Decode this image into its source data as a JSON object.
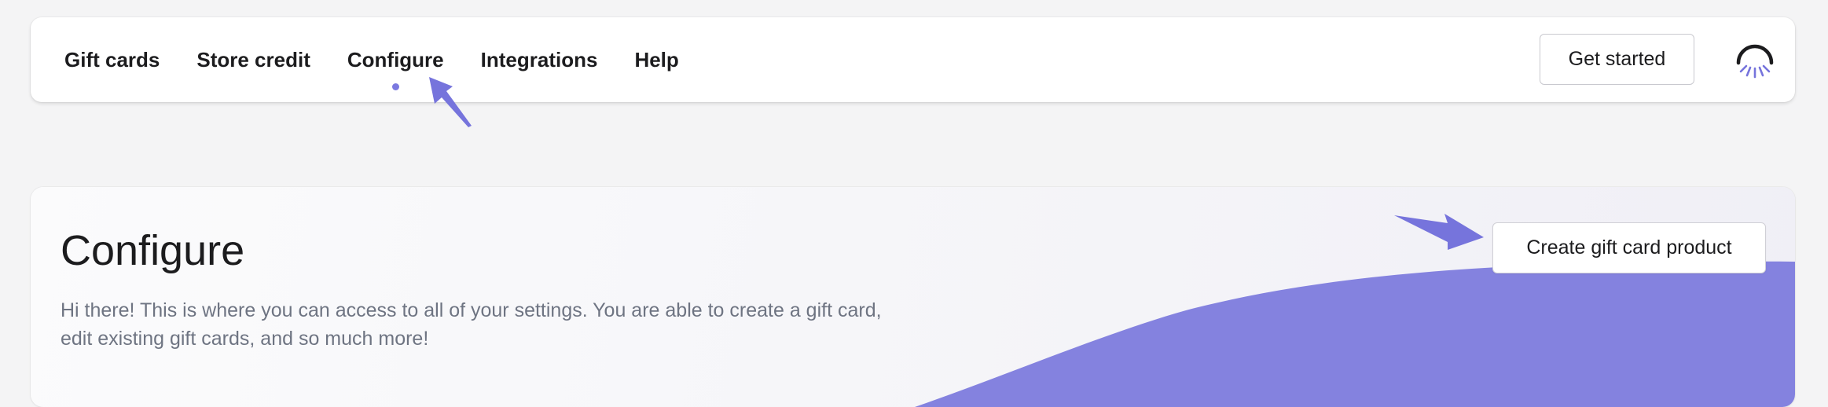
{
  "nav": {
    "items": [
      {
        "label": "Gift cards",
        "active": false
      },
      {
        "label": "Store credit",
        "active": false
      },
      {
        "label": "Configure",
        "active": true
      },
      {
        "label": "Integrations",
        "active": false
      },
      {
        "label": "Help",
        "active": false
      }
    ],
    "active_indicator_color": "#7b79e0",
    "get_started_label": "Get started",
    "logo_icon": "sunrise-logo-icon"
  },
  "page": {
    "title": "Configure",
    "description": "Hi there! This is where you can access to all of your settings. You are able to create a gift card, edit existing gift cards, and so much more!",
    "create_button_label": "Create gift card product"
  },
  "colors": {
    "accent": "#8482df",
    "pointer": "#7674dc",
    "text": "#1c1c1e",
    "muted_text": "#6e7482"
  },
  "annotations": {
    "pointer_icon": "arrow-pointer-icon"
  }
}
